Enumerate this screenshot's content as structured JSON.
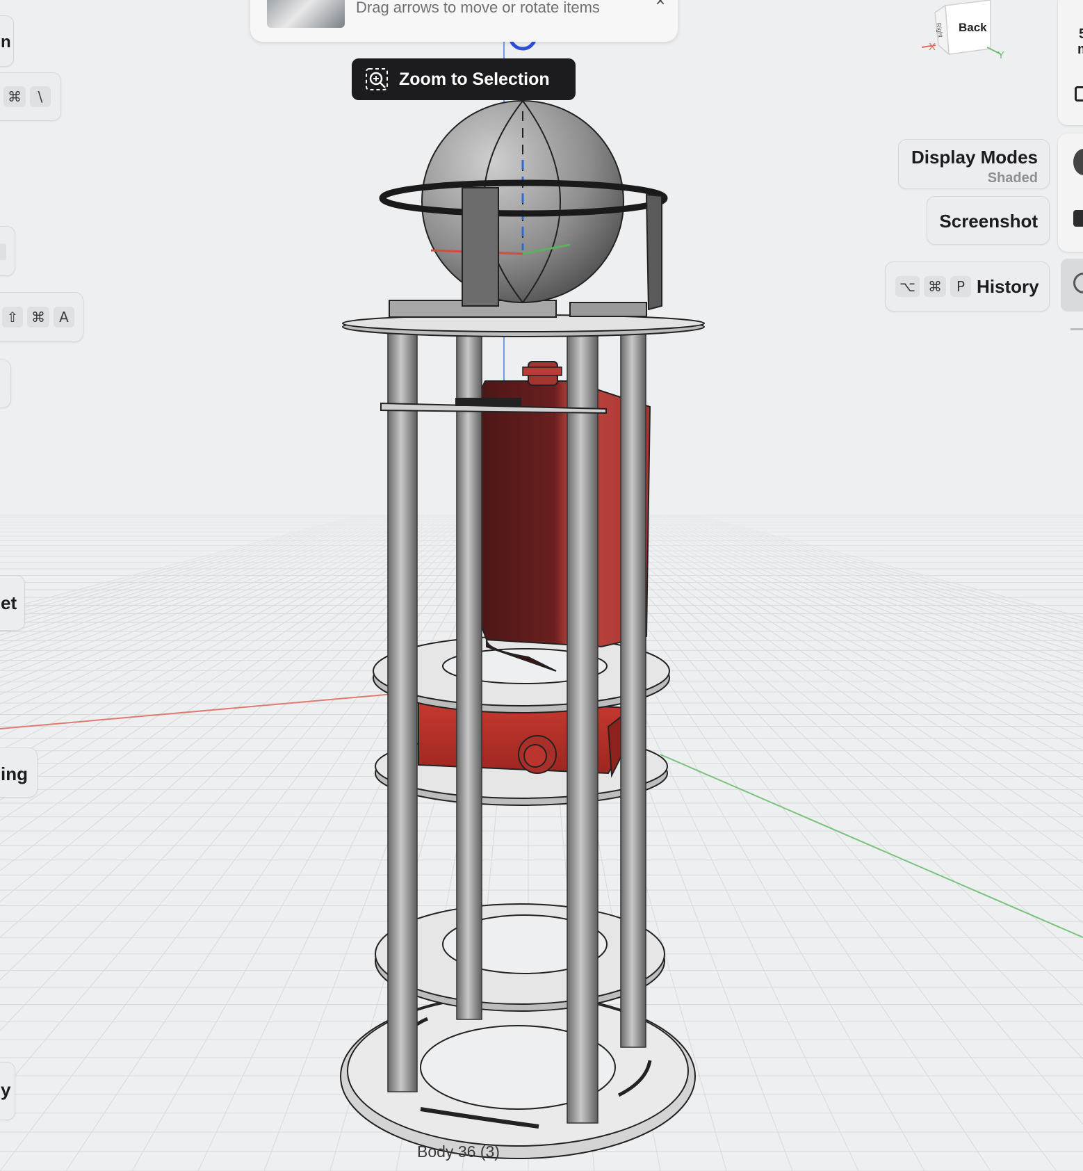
{
  "toast": {
    "message": "Drag arrows to move or rotate items",
    "close_glyph": "×",
    "thumbnail_icon": "cad-part-thumbnail"
  },
  "zoom_to_selection": {
    "label": "Zoom to Selection",
    "icon": "zoom-selection-icon"
  },
  "view_cube": {
    "face_label": "Back",
    "side_label": "Right",
    "axis_x": "X",
    "axis_y": "Y"
  },
  "right_panel": {
    "display_modes": {
      "title": "Display Modes",
      "value": "Shaded"
    },
    "screenshot": {
      "label": "Screenshot"
    },
    "history": {
      "label": "History",
      "shortcut": [
        "⌥",
        "⌘",
        "P"
      ]
    },
    "edge_text_1": "5",
    "edge_text_2": "m"
  },
  "left_panel": {
    "item1_text": "n",
    "shortcut1": [
      "⌘",
      "\\"
    ],
    "shortcut2": [
      "⇧",
      "⌘",
      "A"
    ],
    "item_et": "et",
    "item_ing": "ing",
    "item_y": "y"
  },
  "scene": {
    "body_label": "Body 36 (3)",
    "colors": {
      "background": "#eeeff0",
      "grid": "#d9dadc",
      "metal": "#9c9c9c",
      "red_part": "#b53a35",
      "dark_red": "#5a1a1a",
      "axis_x": "#e06a5e",
      "axis_y": "#6fbf73",
      "axis_z": "#2e6bd6"
    }
  }
}
